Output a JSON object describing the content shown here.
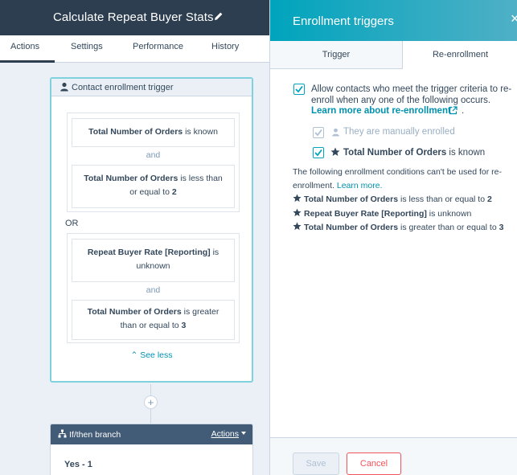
{
  "workflow": {
    "title": "Calculate Repeat Buyer Stats"
  },
  "tabs": [
    {
      "label": "Actions",
      "active": true
    },
    {
      "label": "Settings"
    },
    {
      "label": "Performance"
    },
    {
      "label": "History"
    }
  ],
  "trigger_card": {
    "header": "Contact enrollment trigger",
    "group1": {
      "cond1": {
        "prop": "Total Number of Orders",
        "op": "is known"
      },
      "and": "and",
      "cond2": {
        "prop": "Total Number of Orders",
        "op": "is less than or equal to",
        "value": "2"
      }
    },
    "or_label": "OR",
    "group2": {
      "cond1": {
        "prop": "Repeat Buyer Rate [Reporting]",
        "op": "is unknown"
      },
      "and": "and",
      "cond2": {
        "prop": "Total Number of Orders",
        "op": "is greater than or equal to",
        "value": "3"
      }
    },
    "see_less": "See less"
  },
  "branch_card": {
    "header": "If/then branch",
    "actions_label": "Actions",
    "yes_label": "Yes - 1"
  },
  "panel": {
    "title": "Enrollment triggers",
    "close_glyph": "×",
    "tab_trigger": "Trigger",
    "tab_reenroll": "Re-enrollment",
    "allow_text": "Allow contacts who meet the trigger criteria to re-enroll when any one of the following occurs.",
    "learn_more_reenroll": "Learn more about re-enrollment",
    "learn_more_period": ".",
    "option_manual": "They are manually enrolled",
    "option_orders_prop": "Total Number of Orders",
    "option_orders_op": "is known",
    "cant_text": "The following enrollment conditions can't be used for re-enrollment.",
    "cant_learn_more": "Learn more.",
    "conditions": [
      {
        "prop": "Total Number of Orders",
        "op": "is less than or equal to",
        "value": "2"
      },
      {
        "prop": "Repeat Buyer Rate [Reporting]",
        "op": "is unknown",
        "value": ""
      },
      {
        "prop": "Total Number of Orders",
        "op": "is greater than or equal to",
        "value": "3"
      }
    ],
    "save_label": "Save",
    "cancel_label": "Cancel"
  },
  "colors": {
    "header_dark": "#2d3e50",
    "accent_teal": "#00a4bd",
    "link": "#0091ae",
    "cancel": "#f2545b"
  }
}
